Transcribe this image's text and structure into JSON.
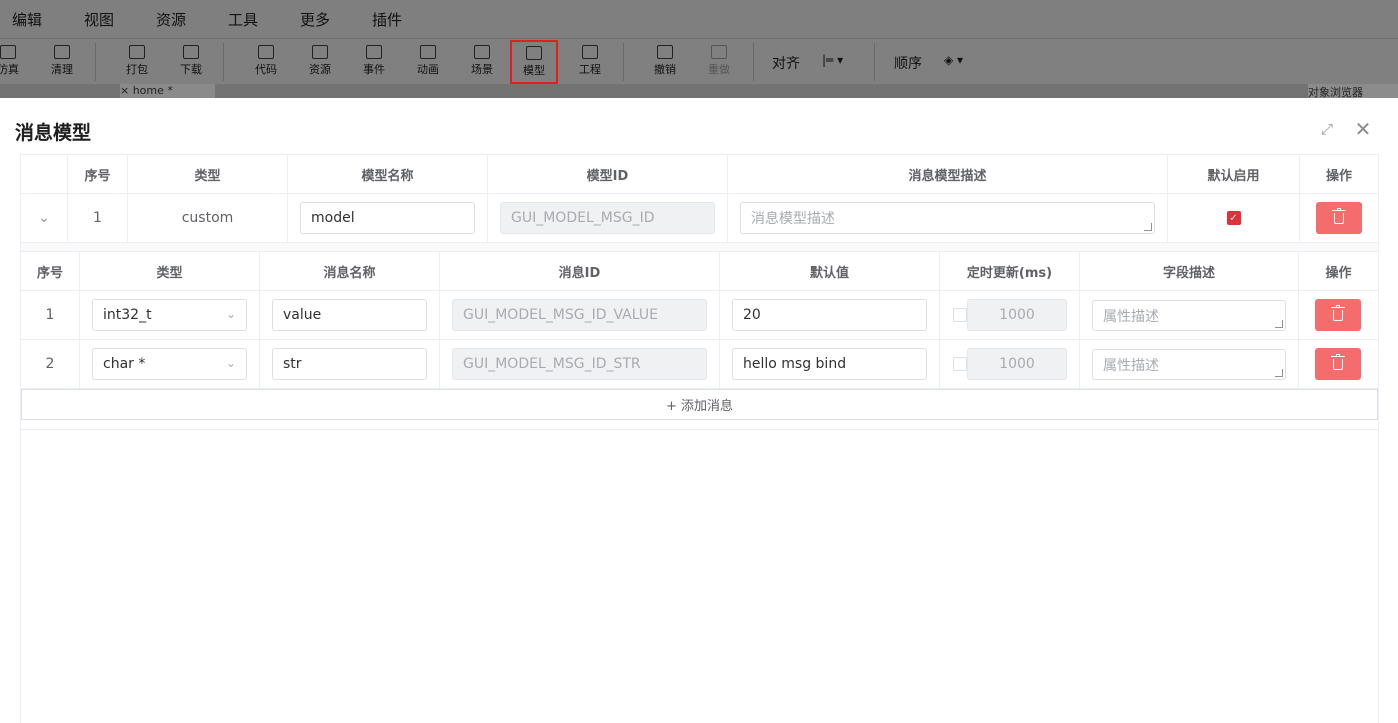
{
  "menu": [
    "编辑",
    "视图",
    "资源",
    "工具",
    "更多",
    "插件"
  ],
  "toolbar": {
    "buttons": [
      {
        "label": "仿真",
        "icon": "simulate-icon"
      },
      {
        "label": "清理",
        "icon": "clean-icon"
      },
      {
        "label": "打包",
        "icon": "package-icon"
      },
      {
        "label": "下载",
        "icon": "download-icon"
      },
      {
        "label": "代码",
        "icon": "code-icon"
      },
      {
        "label": "资源",
        "icon": "resource-icon"
      },
      {
        "label": "事件",
        "icon": "event-icon"
      },
      {
        "label": "动画",
        "icon": "animation-icon"
      },
      {
        "label": "场景",
        "icon": "scene-icon"
      },
      {
        "label": "模型",
        "icon": "model-icon"
      },
      {
        "label": "工程",
        "icon": "project-icon"
      },
      {
        "label": "撤销",
        "icon": "undo-icon"
      },
      {
        "label": "重做",
        "icon": "redo-icon"
      }
    ],
    "align_label": "对齐",
    "order_label": "顺序"
  },
  "tabs": {
    "home": "× home *",
    "object_browser": "对象浏览器"
  },
  "dialog": {
    "title": "消息模型",
    "model_table": {
      "headers": [
        "",
        "序号",
        "类型",
        "模型名称",
        "模型ID",
        "消息模型描述",
        "默认启用",
        "操作"
      ],
      "row": {
        "expand": "⌄",
        "index": "1",
        "type": "custom",
        "name": "model",
        "id": "GUI_MODEL_MSG_ID",
        "desc_placeholder": "消息模型描述",
        "enabled": true
      }
    },
    "msg_table": {
      "headers": [
        "序号",
        "类型",
        "消息名称",
        "消息ID",
        "默认值",
        "定时更新(ms)",
        "字段描述",
        "操作"
      ],
      "rows": [
        {
          "index": "1",
          "type": "int32_t",
          "name": "value",
          "id": "GUI_MODEL_MSG_ID_VALUE",
          "default": "20",
          "timer_enabled": false,
          "interval": "1000",
          "desc_placeholder": "属性描述"
        },
        {
          "index": "2",
          "type": "char *",
          "name": "str",
          "id": "GUI_MODEL_MSG_ID_STR",
          "default": "hello msg bind",
          "timer_enabled": false,
          "interval": "1000",
          "desc_placeholder": "属性描述"
        }
      ]
    },
    "add_message_label": "+ 添加消息"
  },
  "colors": {
    "accent_red": "#e0303a",
    "delete_btn": "#f56c6c",
    "active_tool_border": "#e02020"
  }
}
